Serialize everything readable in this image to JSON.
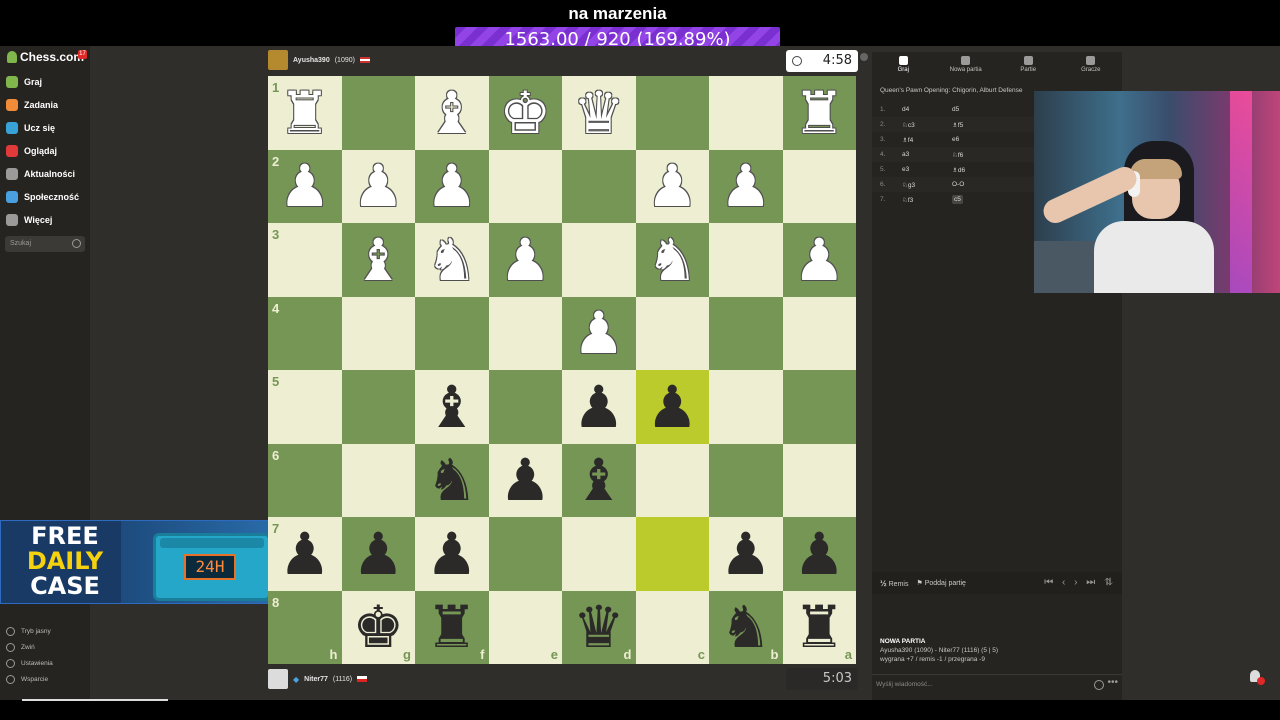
{
  "stream": {
    "goal_title": "na marzenia",
    "goal_progress": "1563.00 / 920 (169.89%)"
  },
  "sidebar": {
    "logo": "Chess.com",
    "logo_badge": "17",
    "items": [
      {
        "label": "Graj",
        "icon": "play-icon",
        "color": "#81b64c"
      },
      {
        "label": "Zadania",
        "icon": "puzzle-icon",
        "color": "#f28c38"
      },
      {
        "label": "Ucz się",
        "icon": "learn-icon",
        "color": "#38a3d6"
      },
      {
        "label": "Oglądaj",
        "icon": "watch-icon",
        "color": "#e03a3a"
      },
      {
        "label": "Aktualności",
        "icon": "news-icon",
        "color": "#9b9a98"
      },
      {
        "label": "Społeczność",
        "icon": "community-icon",
        "color": "#4a9fe0"
      },
      {
        "label": "Więcej",
        "icon": "more-icon",
        "color": "#9b9a98"
      }
    ],
    "search_placeholder": "Szukaj",
    "bottom_items": [
      {
        "label": "Tryb jasny",
        "icon": "light-mode-icon"
      },
      {
        "label": "Zwiń",
        "icon": "collapse-icon"
      },
      {
        "label": "Ustawienia",
        "icon": "settings-icon"
      },
      {
        "label": "Wsparcie",
        "icon": "support-icon"
      }
    ]
  },
  "promo": {
    "line1": "FREE",
    "line2": "DAILY",
    "line3": "CASE",
    "timer": "24H"
  },
  "top_player": {
    "name": "Ayusha390",
    "rating": "(1090)",
    "clock": "4:58"
  },
  "bottom_player": {
    "name": "Niter77",
    "rating": "(1116)",
    "clock": "5:03"
  },
  "board": {
    "rows": [
      [
        "wR",
        "",
        "wB",
        "wK",
        "wQ",
        "",
        "",
        "wR"
      ],
      [
        "wP",
        "wP",
        "wP",
        "",
        "",
        "wP",
        "wP",
        ""
      ],
      [
        "",
        "wB",
        "wN",
        "wP",
        "",
        "wN",
        "",
        "wP"
      ],
      [
        "",
        "",
        "",
        "",
        "wP",
        "",
        "",
        ""
      ],
      [
        "",
        "",
        "bB",
        "",
        "bP",
        "bP",
        "",
        ""
      ],
      [
        "",
        "",
        "bN",
        "bP",
        "bB",
        "",
        "",
        ""
      ],
      [
        "bP",
        "bP",
        "bP",
        "",
        "",
        "",
        "bP",
        "bP"
      ],
      [
        "",
        "bK",
        "bR",
        "",
        "bQ",
        "",
        "bN",
        "bR"
      ]
    ],
    "highlights": [
      [
        4,
        5
      ],
      [
        6,
        5
      ]
    ],
    "rank_labels": [
      "1",
      "2",
      "3",
      "4",
      "5",
      "6",
      "7",
      "8"
    ],
    "file_labels": [
      "h",
      "g",
      "f",
      "e",
      "d",
      "c",
      "b",
      "a"
    ]
  },
  "right_panel": {
    "tabs": [
      {
        "label": "Graj",
        "icon": "bolt-icon"
      },
      {
        "label": "Nowa partia",
        "icon": "plus-icon"
      },
      {
        "label": "Partie",
        "icon": "games-icon"
      },
      {
        "label": "Gracze",
        "icon": "players-icon"
      }
    ],
    "opening": "Queen's Pawn Opening: Chigorin, Alburt Defense",
    "moves": [
      {
        "num": "1.",
        "w": "d4",
        "b": "d5"
      },
      {
        "num": "2.",
        "w": "♘c3",
        "b": "♗f5"
      },
      {
        "num": "3.",
        "w": "♗f4",
        "b": "e6"
      },
      {
        "num": "4.",
        "w": "a3",
        "b": "♘f6"
      },
      {
        "num": "5.",
        "w": "e3",
        "b": "♗d6"
      },
      {
        "num": "6.",
        "w": "♘g3",
        "b": "O-O"
      },
      {
        "num": "7.",
        "w": "♘f3",
        "b": "c5"
      }
    ],
    "remis": "Remis",
    "resign": "Poddaj partię",
    "game_title": "NOWA PARTIA",
    "game_players": "Ayusha390 (1090) - Niter77 (1116) (5 | 5)",
    "game_stats": "wygrana +7 / remis -1 / przegrana -9",
    "chat_placeholder": "Wyślij wiadomość..."
  }
}
